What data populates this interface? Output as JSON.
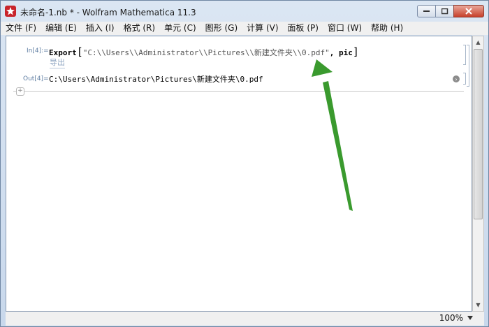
{
  "window": {
    "title": "未命名-1.nb * - Wolfram Mathematica 11.3",
    "app_icon": "mathematica-icon"
  },
  "menu": {
    "items": [
      "文件 (F)",
      "编辑 (E)",
      "插入 (I)",
      "格式 (R)",
      "单元 (C)",
      "图形 (G)",
      "计算 (V)",
      "面板 (P)",
      "窗口 (W)",
      "帮助 (H)"
    ]
  },
  "notebook": {
    "input_label": "In[4]:=",
    "input_func": "Export",
    "input_string": "\"C:\\\\Users\\\\Administrator\\\\Pictures\\\\新建文件夹\\\\0.pdf\"",
    "input_arg": ", pic",
    "input_hint": "导出",
    "output_label": "Out[4]=",
    "output_text": "C:\\Users\\Administrator\\Pictures\\新建文件夹\\0.pdf"
  },
  "status": {
    "zoom": "100%"
  },
  "colors": {
    "annotation_arrow": "#3a9a2e",
    "title_icon": "#c8242b",
    "cell_label": "#5f7ea3"
  }
}
